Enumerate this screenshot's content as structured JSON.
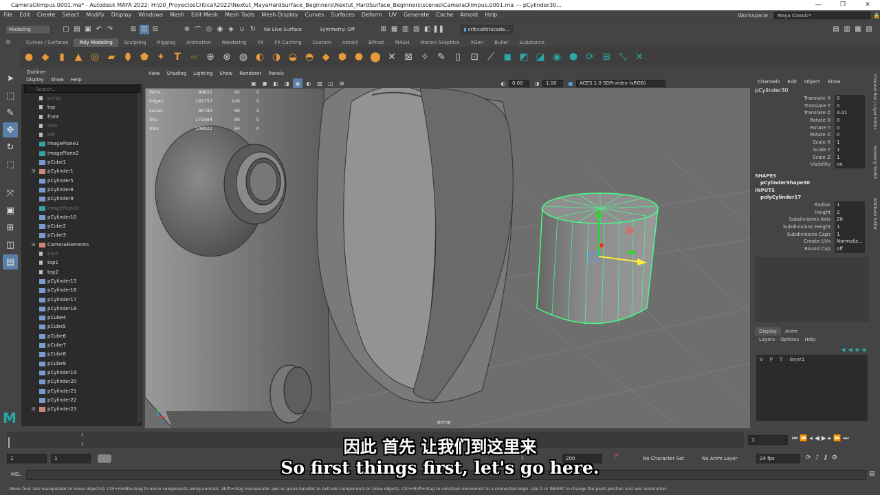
{
  "window": {
    "title": "CameraOlimpus.0001.ma* - Autodesk MAYA 2022: H:\\00_ProyectosCritical\\2022\\Nextut_MayaHardSurface_Beginners\\Nextut_HardSurface_Beginners\\scenes\\CameraOlimpus.0001.ma   ---   pCylinder30...",
    "minimize": "—",
    "maximize": "❐",
    "close": "✕"
  },
  "menubar": {
    "items": [
      "File",
      "Edit",
      "Create",
      "Select",
      "Modify",
      "Display",
      "Windows",
      "Mesh",
      "Edit Mesh",
      "Mesh Tools",
      "Mesh Display",
      "Curves",
      "Surfaces",
      "Deform",
      "UV",
      "Generate",
      "Cache",
      "Arnold",
      "Help"
    ],
    "workspace_label": "Workspace :",
    "workspace_value": "Maya Classic*"
  },
  "statusline": {
    "mode": "Modeling",
    "live_surface": "No Live Surface",
    "symmetry": "Symmetry: Off",
    "user": "criticalhitacade..."
  },
  "shelf": {
    "tabs": [
      "Curves / Surfaces",
      "Poly Modeling",
      "Sculpting",
      "Rigging",
      "Animation",
      "Rendering",
      "FX",
      "FX Caching",
      "Custom",
      "Arnold",
      "Bifrost",
      "MASH",
      "Motion Graphics",
      "XGen",
      "Bullet",
      "Substance"
    ],
    "active_tab": 1
  },
  "outliner": {
    "title": "Outliner",
    "menu": [
      "Display",
      "Show",
      "Help"
    ],
    "search_placeholder": "Search...",
    "items": [
      {
        "label": "persp",
        "dim": true,
        "type": "camera"
      },
      {
        "label": "top",
        "dim": false,
        "type": "camera"
      },
      {
        "label": "front",
        "dim": false,
        "type": "camera"
      },
      {
        "label": "side",
        "dim": true,
        "type": "camera"
      },
      {
        "label": "left",
        "dim": true,
        "type": "camera"
      },
      {
        "label": "imagePlane1",
        "dim": false,
        "type": "image"
      },
      {
        "label": "imagePlane2",
        "dim": false,
        "type": "image"
      },
      {
        "label": "pCube1",
        "dim": false,
        "type": "mesh"
      },
      {
        "label": "pCylinder1",
        "dim": false,
        "type": "group"
      },
      {
        "label": "pCylinder5",
        "dim": false,
        "type": "mesh"
      },
      {
        "label": "pCylinder8",
        "dim": false,
        "type": "mesh"
      },
      {
        "label": "pCylinder9",
        "dim": false,
        "type": "mesh"
      },
      {
        "label": "imagePlane3",
        "dim": true,
        "type": "image"
      },
      {
        "label": "pCylinder10",
        "dim": false,
        "type": "mesh"
      },
      {
        "label": "pCube2",
        "dim": false,
        "type": "mesh"
      },
      {
        "label": "pCube3",
        "dim": false,
        "type": "mesh"
      },
      {
        "label": "CameraElements",
        "dim": false,
        "type": "group"
      },
      {
        "label": "back",
        "dim": true,
        "type": "camera"
      },
      {
        "label": "top1",
        "dim": false,
        "type": "camera"
      },
      {
        "label": "top2",
        "dim": false,
        "type": "camera"
      },
      {
        "label": "pCylinder15",
        "dim": false,
        "type": "mesh"
      },
      {
        "label": "pCylinder16",
        "dim": false,
        "type": "mesh"
      },
      {
        "label": "pCylinder17",
        "dim": false,
        "type": "mesh"
      },
      {
        "label": "pCylinder18",
        "dim": false,
        "type": "mesh"
      },
      {
        "label": "pCube4",
        "dim": false,
        "type": "mesh"
      },
      {
        "label": "pCube5",
        "dim": false,
        "type": "mesh"
      },
      {
        "label": "pCube6",
        "dim": false,
        "type": "mesh"
      },
      {
        "label": "pCube7",
        "dim": false,
        "type": "mesh"
      },
      {
        "label": "pCube8",
        "dim": false,
        "type": "mesh"
      },
      {
        "label": "pCube9",
        "dim": false,
        "type": "mesh"
      },
      {
        "label": "pCylinder19",
        "dim": false,
        "type": "mesh"
      },
      {
        "label": "pCylinder20",
        "dim": false,
        "type": "mesh"
      },
      {
        "label": "pCylinder21",
        "dim": false,
        "type": "mesh"
      },
      {
        "label": "pCylinder22",
        "dim": false,
        "type": "mesh"
      },
      {
        "label": "pCylinder23",
        "dim": false,
        "type": "group"
      }
    ]
  },
  "viewport": {
    "menu": [
      "View",
      "Shading",
      "Lighting",
      "Show",
      "Renderer",
      "Panels"
    ],
    "exposure": "0.00",
    "gamma": "1.00",
    "colorspace": "ACES 1.0 SDR-video (sRGB)",
    "camera_label": "persp",
    "hud": [
      {
        "k": "Verts:",
        "v": "89021",
        "s": "42",
        "z": "0"
      },
      {
        "k": "Edges:",
        "v": "185757",
        "s": "100",
        "z": "0"
      },
      {
        "k": "Faces:",
        "v": "96783",
        "s": "60",
        "z": "0"
      },
      {
        "k": "Tris:",
        "v": "175984",
        "s": "80",
        "z": "0"
      },
      {
        "k": "UVs:",
        "v": "108922",
        "s": "84",
        "z": "0"
      }
    ]
  },
  "channelbox": {
    "menu": [
      "Channels",
      "Edit",
      "Object",
      "Show"
    ],
    "object": "pCylinder30",
    "transform": [
      {
        "k": "Translate X",
        "v": "0"
      },
      {
        "k": "Translate Y",
        "v": "0"
      },
      {
        "k": "Translate Z",
        "v": "4.41"
      },
      {
        "k": "Rotate X",
        "v": "0"
      },
      {
        "k": "Rotate Y",
        "v": "0"
      },
      {
        "k": "Rotate Z",
        "v": "0"
      },
      {
        "k": "Scale X",
        "v": "1"
      },
      {
        "k": "Scale Y",
        "v": "1"
      },
      {
        "k": "Scale Z",
        "v": "1"
      },
      {
        "k": "Visibility",
        "v": "on"
      }
    ],
    "shapes_label": "SHAPES",
    "shape_name": "pCylinderShape30",
    "inputs_label": "INPUTS",
    "input_name": "polyCylinder17",
    "inputs": [
      {
        "k": "Radius",
        "v": "1"
      },
      {
        "k": "Height",
        "v": "2"
      },
      {
        "k": "Subdivisions Axis",
        "v": "20"
      },
      {
        "k": "Subdivisions Height",
        "v": "1"
      },
      {
        "k": "Subdivisions Caps",
        "v": "1"
      },
      {
        "k": "Create UVs",
        "v": "Normaliz..."
      },
      {
        "k": "Round Cap",
        "v": "off"
      }
    ]
  },
  "layers": {
    "tabs": [
      "Display",
      "Anim"
    ],
    "menu": [
      "Layers",
      "Options",
      "Help"
    ],
    "layer_v": "V",
    "layer_p": "P",
    "layer_t": "T",
    "layer_name": "layer1"
  },
  "sidetabs": [
    "Channel Box / Layer Editor",
    "Modeling Toolkit",
    "Attribute Editor"
  ],
  "timeslider": {
    "tick1": "1",
    "current_frame": "1",
    "current_field": "1"
  },
  "range": {
    "start": "1",
    "anim_start": "1",
    "end_marker": "2",
    "anim_end": "200",
    "character_set": "No Character Set",
    "anim_layer": "No Anim Layer",
    "fps": "24 fps"
  },
  "cmdline": {
    "label": "MEL"
  },
  "helpline": "Move Tool: Use manipulator to move object(s). Ctrl+middle-drag to move components along normals. Shift+drag manipulator axis or plane handles to extrude components or clone objects. Ctrl+Shift+drag to constrain movement to a connected edge. Use D or INSERT to change the pivot position and axis orientation.",
  "subtitles": {
    "cn": "因此 首先 让我们到这里来",
    "en": "So first things first, let's go here."
  },
  "colors": {
    "selection_green": "#44ff88",
    "maya_teal": "#2aa7a7",
    "shelf_orange": "#e69b3a"
  }
}
